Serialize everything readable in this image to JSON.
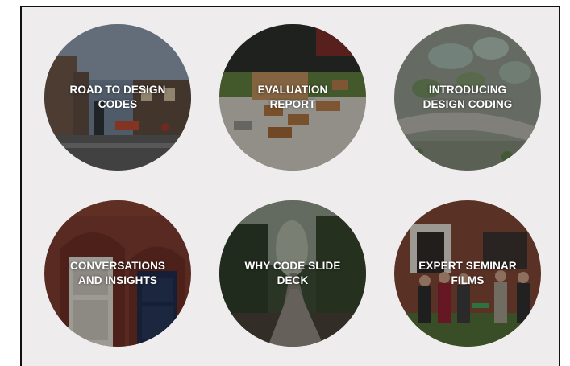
{
  "tiles": [
    {
      "id": "road-to-design-codes",
      "label_line1": "ROAD TO DESIGN",
      "label_line2": "CODES"
    },
    {
      "id": "evaluation-report",
      "label_line1": "EVALUATION",
      "label_line2": "REPORT"
    },
    {
      "id": "introducing-design-coding",
      "label_line1": "INTRODUCING",
      "label_line2": "DESIGN CODING"
    },
    {
      "id": "conversations-and-insights",
      "label_line1": "CONVERSATIONS",
      "label_line2": "AND INSIGHTS"
    },
    {
      "id": "why-code-slide-deck",
      "label_line1": "WHY CODE SLIDE",
      "label_line2": "DECK"
    },
    {
      "id": "expert-seminar-films",
      "label_line1": "EXPERT SEMINAR",
      "label_line2": "FILMS"
    }
  ],
  "colors": {
    "panel_background": "#eeecec",
    "panel_border": "#111111",
    "label_text": "#ffffff"
  }
}
